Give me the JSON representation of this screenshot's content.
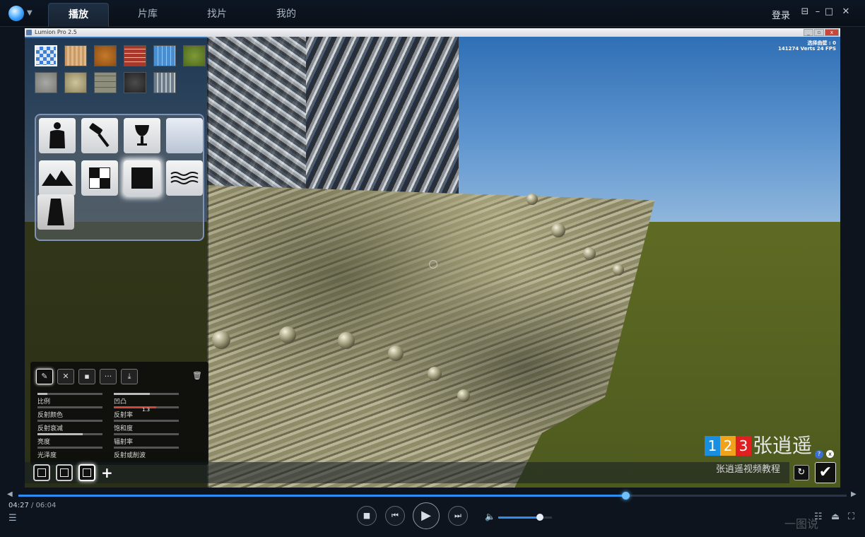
{
  "player": {
    "tabs": [
      {
        "label": "播放",
        "active": true
      },
      {
        "label": "片库",
        "active": false
      },
      {
        "label": "找片",
        "active": false
      },
      {
        "label": "我的",
        "active": false
      }
    ],
    "login_label": "登录",
    "window_buttons": [
      "skin-icon",
      "minimize-icon",
      "maximize-icon",
      "close-icon"
    ]
  },
  "lumion": {
    "window_title": "Lumion Pro  2.5",
    "hud_line1": "选择曲壁 : 0",
    "hud_line2": "141274 Verts 24 FPS"
  },
  "material_panel": {
    "swatches": [
      "checker-blue",
      "wood-light",
      "wood-orange",
      "brick-red",
      "tile-blue",
      "grass-green",
      "concrete-gray",
      "gravel-beige",
      "stone-gray",
      "asphalt-dark",
      "metal-panel"
    ],
    "categories": [
      "person-icon",
      "paint-roller-icon",
      "glass-icon",
      "blank-tile",
      "mountain-icon",
      "checker-icon",
      "solid-square-icon",
      "water-waves-icon",
      "extra-tile"
    ],
    "selected_category_index": 6,
    "tool_buttons": [
      "edit-icon",
      "map-icon",
      "texture-icon",
      "more-icon",
      "save-icon",
      "delete-icon"
    ],
    "sliders": [
      {
        "label": "比例",
        "level": 0.15
      },
      {
        "label": "凹凸",
        "level": 0.55
      },
      {
        "label": "反射颜色",
        "level": 0.0
      },
      {
        "label": "反射率",
        "level": 0.65,
        "value": "1.3"
      },
      {
        "label": "反射衰减",
        "level": 0.0
      },
      {
        "label": "饱和度",
        "level": 0.0
      },
      {
        "label": "亮度",
        "level": 0.7
      },
      {
        "label": "辐射率",
        "level": 0.0
      },
      {
        "label": "光泽度",
        "level": 0.0
      },
      {
        "label": "反射或削波",
        "level": 0.0
      }
    ],
    "bottom_slots": 3
  },
  "brand": {
    "digits": [
      "1",
      "2",
      "3"
    ],
    "digit_colors": [
      "#1a8fe0",
      "#f0a21c",
      "#e02020"
    ],
    "name": "张逍遥",
    "subtitle": "张逍遥视频教程"
  },
  "playback": {
    "current_time": "04:27",
    "total_time": "/ 06:04",
    "progress": 0.733,
    "volume": 0.78
  },
  "watermark": "一图说"
}
